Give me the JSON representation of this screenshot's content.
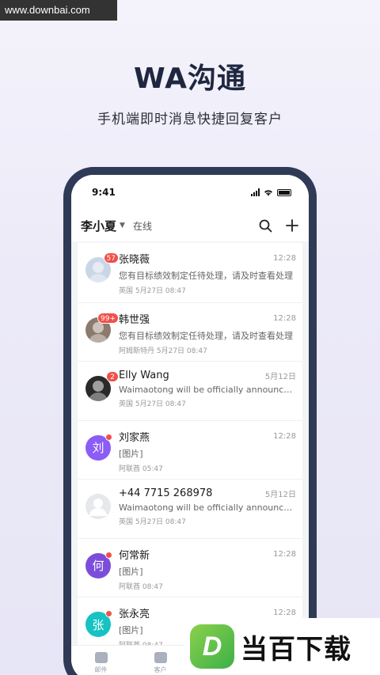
{
  "watermark": "www.downbai.com",
  "hero": {
    "title": "WA沟通",
    "subtitle": "手机端即时消息快捷回复客户"
  },
  "status_bar": {
    "time": "9:41"
  },
  "app_bar": {
    "user_name": "李小夏",
    "status": "在线",
    "search_icon": "search-icon",
    "add_icon": "plus-icon"
  },
  "conversations": [
    {
      "name": "张晓薇",
      "time": "12:28",
      "message": "您有目标绩效制定任待处理，请及时查看处理",
      "meta": "英国 5月27日 08:47",
      "badge": "57",
      "avatar_text": "",
      "avatar_color": "#c9d6e6"
    },
    {
      "name": "韩世强",
      "time": "12:28",
      "message": "您有目标绩效制定任待处理，请及时查看处理",
      "meta": "阿姆斯特丹 5月27日 08:47",
      "badge": "99+",
      "avatar_text": "",
      "avatar_color": "#8c7a6c"
    },
    {
      "name": "Elly Wang",
      "time": "5月12日",
      "message": "Waimaotong will be officially announced t...",
      "meta": "英国 5月27日 08:47",
      "badge": "2",
      "avatar_text": "",
      "avatar_color": "#2a2a2a"
    },
    {
      "name": "刘家燕",
      "time": "12:28",
      "message": "[图片]",
      "meta": "阿联酋 05:47",
      "badge": "",
      "avatar_text": "刘",
      "avatar_color": "#8b5cf6"
    },
    {
      "name": "+44 7715 268978",
      "time": "5月12日",
      "message": "Waimaotong will be officially announced t...",
      "meta": "英国 5月27日 08:47",
      "badge": "",
      "avatar_text": "",
      "avatar_color": "#e6e8ec"
    },
    {
      "name": "何常新",
      "time": "12:28",
      "message": "[图片]",
      "meta": "阿联酋 08:47",
      "badge": "",
      "avatar_text": "何",
      "avatar_color": "#7c4ddb"
    },
    {
      "name": "张永亮",
      "time": "12:28",
      "message": "[图片]",
      "meta": "阿联酋 08:47",
      "badge": "",
      "avatar_text": "张",
      "avatar_color": "#16c2c2"
    }
  ],
  "tabbar": {
    "tabs": [
      "邮件",
      "客户",
      "",
      ""
    ]
  },
  "site_logo": {
    "mark": "D",
    "text": "当百下载"
  },
  "colors": {
    "accent": "#3e86f5",
    "badge": "#f0504a",
    "phone_frame": "#2f3a56"
  }
}
